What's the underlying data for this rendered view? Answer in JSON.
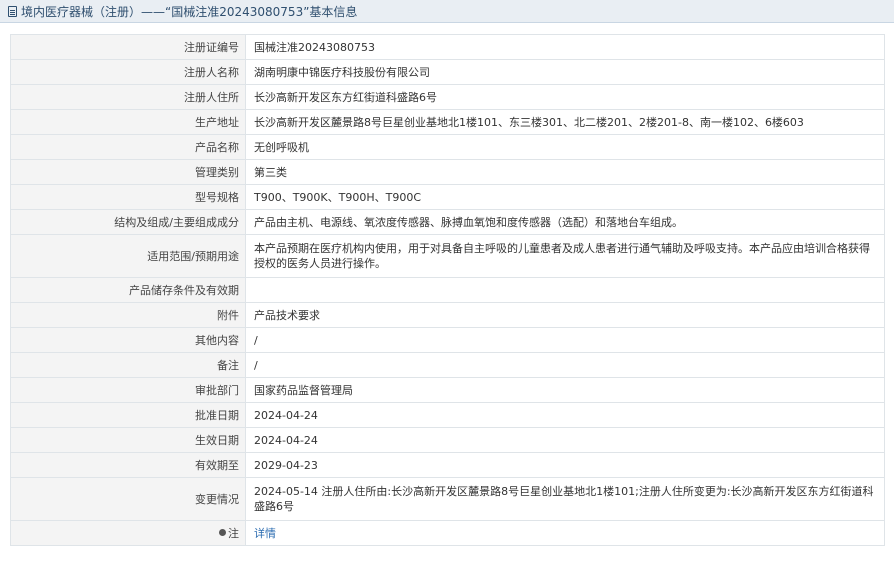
{
  "header": {
    "title": "境内医疗器械（注册）——“国械注准20243080753”基本信息"
  },
  "rows": [
    {
      "label": "注册证编号",
      "value": "国械注准20243080753"
    },
    {
      "label": "注册人名称",
      "value": "湖南明康中锦医疗科技股份有限公司"
    },
    {
      "label": "注册人住所",
      "value": "长沙高新开发区东方红街道科盛路6号"
    },
    {
      "label": "生产地址",
      "value": "长沙高新开发区麓景路8号巨星创业基地北1楼101、东三楼301、北二楼201、2楼201-8、南一楼102、6楼603"
    },
    {
      "label": "产品名称",
      "value": "无创呼吸机"
    },
    {
      "label": "管理类别",
      "value": "第三类"
    },
    {
      "label": "型号规格",
      "value": "T900、T900K、T900H、T900C"
    },
    {
      "label": "结构及组成/主要组成成分",
      "value": "产品由主机、电源线、氧浓度传感器、脉搏血氧饱和度传感器（选配）和落地台车组成。"
    },
    {
      "label": "适用范围/预期用途",
      "value": "本产品预期在医疗机构内使用，用于对具备自主呼吸的儿童患者及成人患者进行通气辅助及呼吸支持。本产品应由培训合格获得授权的医务人员进行操作。"
    },
    {
      "label": "产品储存条件及有效期",
      "value": ""
    },
    {
      "label": "附件",
      "value": "产品技术要求"
    },
    {
      "label": "其他内容",
      "value": "/"
    },
    {
      "label": "备注",
      "value": "/"
    },
    {
      "label": "审批部门",
      "value": "国家药品监督管理局"
    },
    {
      "label": "批准日期",
      "value": "2024-04-24"
    },
    {
      "label": "生效日期",
      "value": "2024-04-24"
    },
    {
      "label": "有效期至",
      "value": "2029-04-23"
    },
    {
      "label": "变更情况",
      "value": "2024-05-14 注册人住所由:长沙高新开发区麓景路8号巨星创业基地北1楼101;注册人住所变更为:长沙高新开发区东方红街道科盛路6号"
    }
  ],
  "note_row": {
    "label": "注",
    "link": "详情",
    "icon": "pin-icon"
  }
}
